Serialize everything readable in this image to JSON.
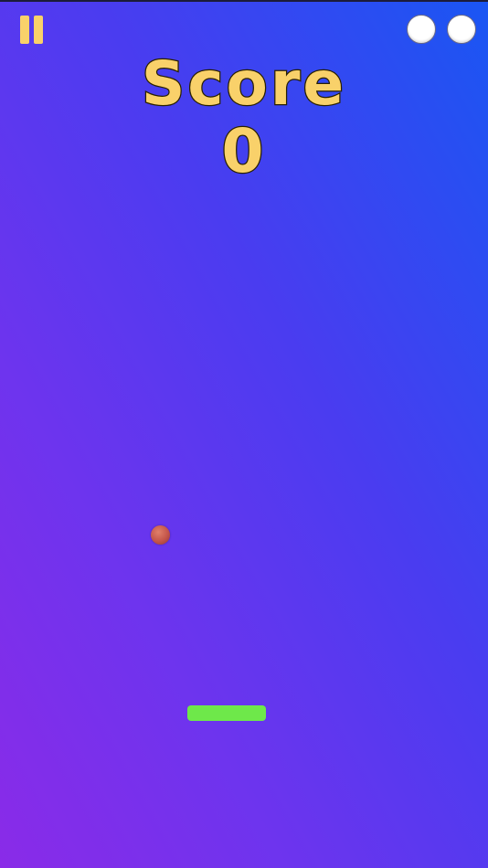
{
  "hud": {
    "score_label": "Score",
    "score_value": "0",
    "lives_remaining": 2
  },
  "icons": {
    "pause": "pause-icon",
    "life": "life-indicator-icon"
  },
  "colors": {
    "hud_text": "#f9d16a",
    "paddle": "#6ee84a",
    "ball": "#c4554a",
    "background_top": "#1a56f3",
    "background_bottom": "#8a2be8"
  }
}
